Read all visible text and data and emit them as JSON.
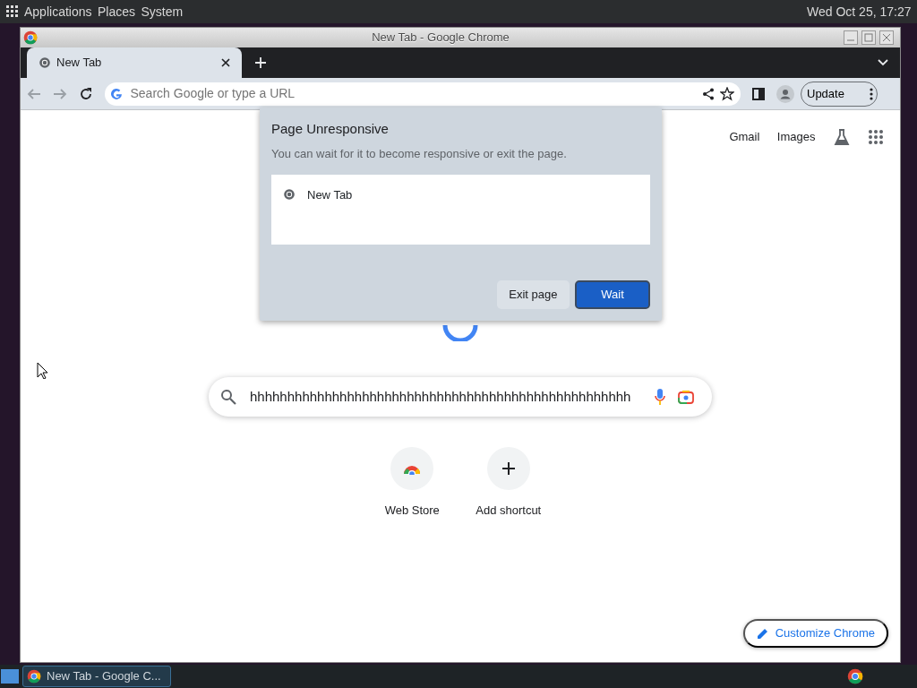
{
  "top_panel": {
    "menus": [
      "Applications",
      "Places",
      "System"
    ],
    "clock": "Wed Oct 25, 17:27"
  },
  "window": {
    "title": "New Tab - Google Chrome"
  },
  "tabs": [
    {
      "label": "New Tab",
      "selected": true
    }
  ],
  "omnibox": {
    "placeholder": "Search Google or type a URL"
  },
  "update_button": "Update",
  "page": {
    "header_links": [
      "Gmail",
      "Images"
    ],
    "search": {
      "value": "hhhhhhhhhhhhhhhhhhhhhhhhhhhhhhhhhhhhhhhhhhhhhhhhhhh"
    },
    "shortcuts": [
      {
        "label": "Web Store",
        "kind": "store"
      },
      {
        "label": "Add shortcut",
        "kind": "add"
      }
    ],
    "customize_button": "Customize Chrome"
  },
  "dialog": {
    "title": "Page Unresponsive",
    "message": "You can wait for it to become responsive or exit the page.",
    "pages": [
      "New Tab"
    ],
    "buttons": [
      {
        "label": "Exit page",
        "kind": "secondary"
      },
      {
        "label": "Wait",
        "kind": "primary"
      }
    ]
  },
  "taskbar": {
    "items": [
      {
        "label": "New Tab - Google C...",
        "selected": true
      }
    ]
  }
}
